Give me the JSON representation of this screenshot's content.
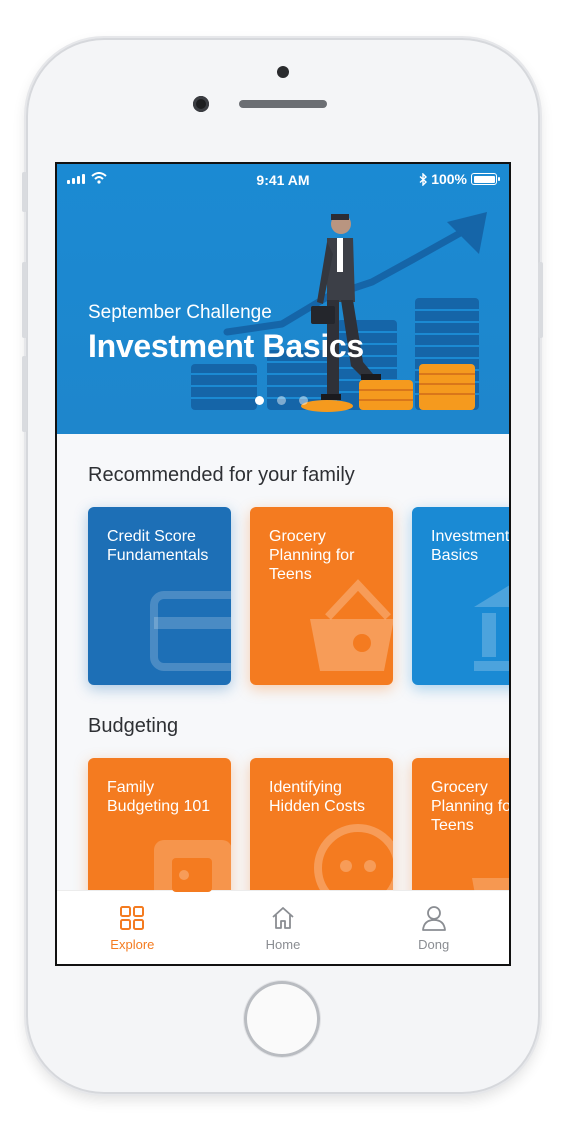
{
  "status_bar": {
    "time": "9:41 AM",
    "battery": "100%"
  },
  "hero": {
    "subtitle": "September Challenge",
    "title": "Investment Basics",
    "carousel_dots": 3,
    "active_dot": 0
  },
  "sections": [
    {
      "title": "Recommended for your family",
      "cards": [
        {
          "title": "Credit Score Fundamentals",
          "color": "#1d6fb6",
          "icon": "credit-card-icon"
        },
        {
          "title": "Grocery Planning for Teens",
          "color": "#f47b20",
          "icon": "shopping-basket-icon"
        },
        {
          "title": "Investment Basics",
          "color": "#1a8ad4",
          "icon": "bank-icon"
        }
      ]
    },
    {
      "title": "Budgeting",
      "cards": [
        {
          "title": "Family Budgeting 101",
          "color": "#f47b20",
          "icon": "wallet-icon"
        },
        {
          "title": "Identifying Hidden Costs",
          "color": "#f47b20",
          "icon": "face-icon"
        },
        {
          "title": "Grocery Planning for Teens",
          "color": "#f47b20",
          "icon": "shopping-basket-icon"
        }
      ]
    }
  ],
  "tabbar": {
    "items": [
      {
        "label": "Explore",
        "icon": "grid-icon",
        "active": true
      },
      {
        "label": "Home",
        "icon": "home-icon",
        "active": false
      },
      {
        "label": "Dong",
        "icon": "person-icon",
        "active": false
      }
    ]
  },
  "colors": {
    "accent": "#f47b20",
    "hero_blue": "#1b8ad3",
    "navy": "#1d6fb6"
  }
}
